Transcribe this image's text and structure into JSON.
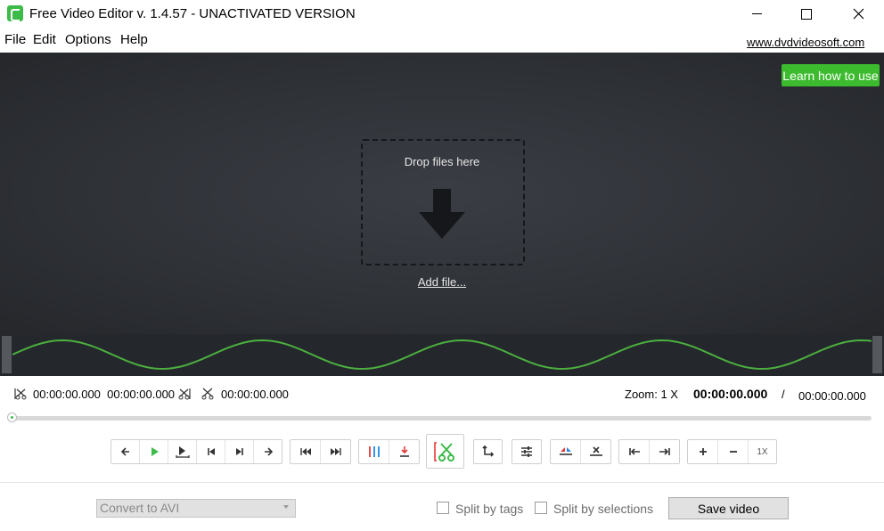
{
  "window": {
    "title": "Free Video Editor v. 1.4.57 - UNACTIVATED VERSION"
  },
  "menu": {
    "items": [
      "File",
      "Edit",
      "Options",
      "Help"
    ],
    "site_link": "www.dvdvideosoft.com"
  },
  "preview": {
    "learn_button": "Learn how to use",
    "drop_text": "Drop files here",
    "add_file": "Add file..."
  },
  "info": {
    "selection_range": "00:00:00.000  00:00:00.000",
    "cut_time": "00:00:00.000",
    "zoom": "Zoom: 1 X",
    "current_time": "00:00:00.000",
    "separator": "/",
    "total_time": "00:00:00.000"
  },
  "toolbar": {
    "zoom_reset": "1X"
  },
  "bottom": {
    "format": "Convert to AVI",
    "split_by_tags": "Split by tags",
    "split_by_selections": "Split by selections",
    "save_video": "Save video"
  },
  "colors": {
    "accent_green": "#3dbb2f",
    "preview_bg": "#2f3237",
    "waveform": "#4caf3f"
  }
}
